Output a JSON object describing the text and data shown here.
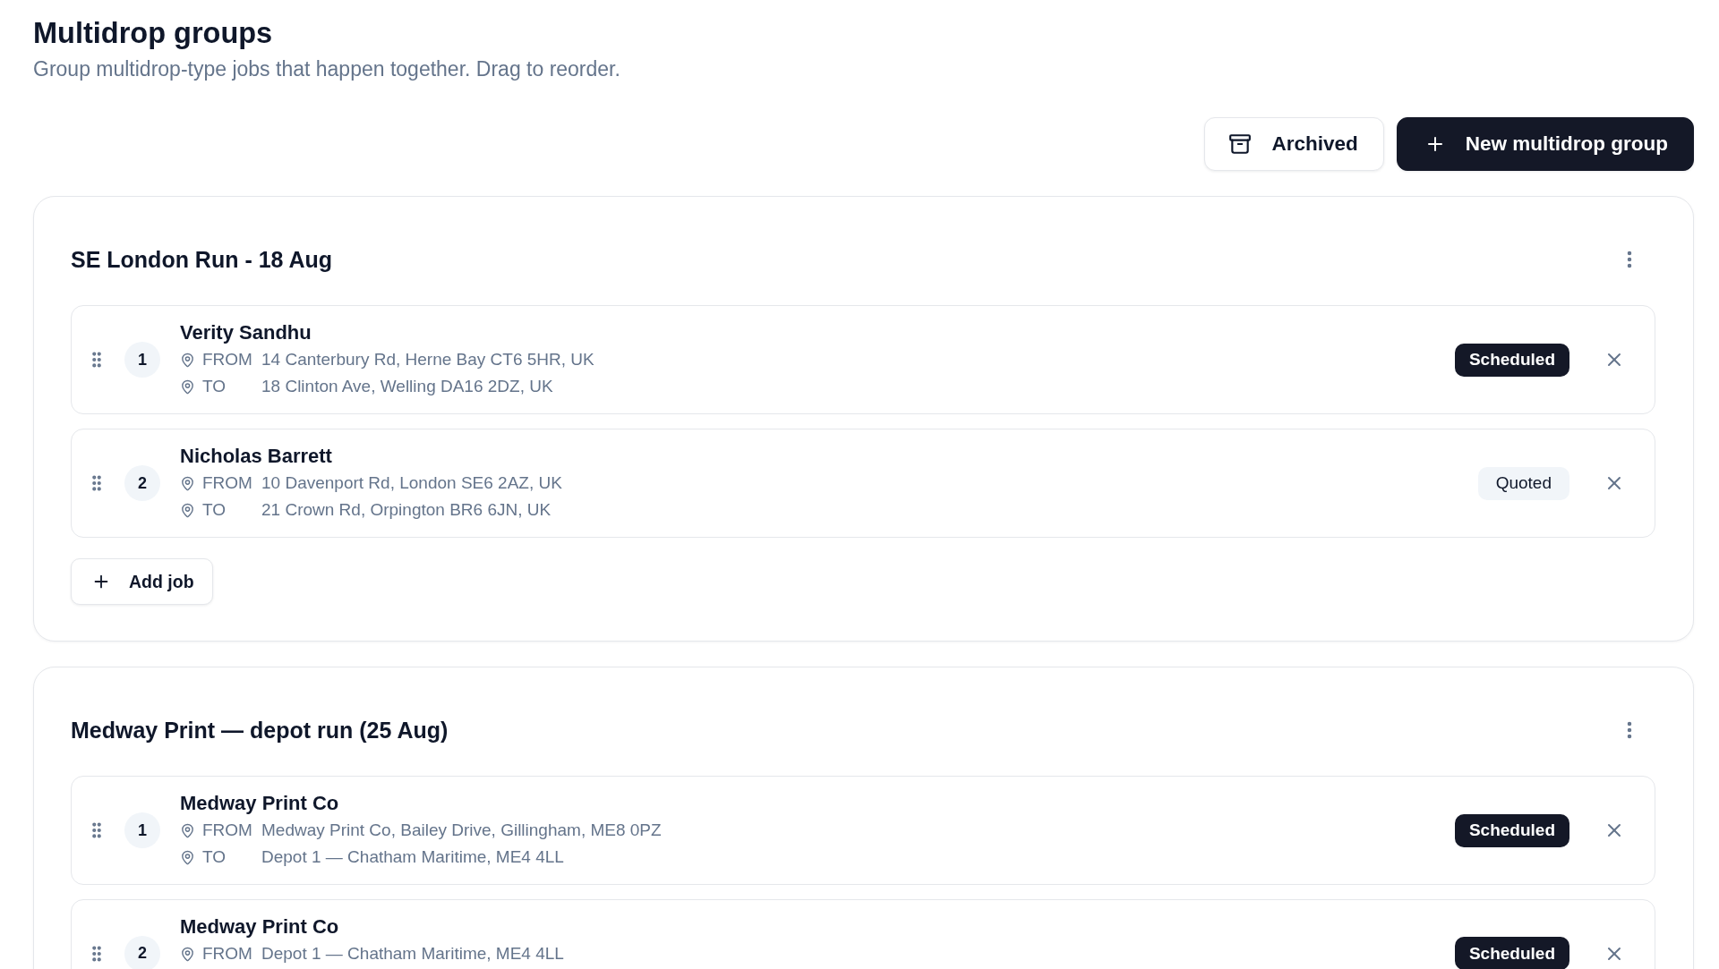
{
  "page": {
    "title": "Multidrop groups",
    "subtitle": "Group multidrop-type jobs that happen together. Drag to reorder."
  },
  "actions": [
    {
      "kind": "secondary",
      "label": "Archived"
    },
    {
      "kind": "primary",
      "label": "New multidrop group"
    }
  ],
  "groups": [
    {
      "title": "SE London Run - 18 Aug",
      "jobs": [
        {
          "number": "1",
          "name": "Verity Sandhu",
          "stops": [
            {
              "label": "FROM",
              "address": "14 Canterbury Rd, Herne Bay CT6 5HR, UK"
            },
            {
              "label": "TO",
              "address": "18 Clinton Ave, Welling DA16 2DZ, UK"
            }
          ],
          "status": {
            "kind": "scheduled",
            "label": "Scheduled"
          }
        },
        {
          "number": "2",
          "name": "Nicholas Barrett",
          "stops": [
            {
              "label": "FROM",
              "address": "10 Davenport Rd, London SE6 2AZ, UK"
            },
            {
              "label": "TO",
              "address": "21 Crown Rd, Orpington BR6 6JN, UK"
            }
          ],
          "status": {
            "kind": "quoted",
            "label": "Quoted"
          }
        }
      ],
      "add_job": "Add job"
    },
    {
      "title": "Medway Print — depot run (25 Aug)",
      "jobs": [
        {
          "number": "1",
          "name": "Medway Print Co",
          "stops": [
            {
              "label": "FROM",
              "address": "Medway Print Co, Bailey Drive, Gillingham, ME8 0PZ"
            },
            {
              "label": "TO",
              "address": "Depot 1 — Chatham Maritime, ME4 4LL"
            }
          ],
          "status": {
            "kind": "scheduled",
            "label": "Scheduled"
          }
        },
        {
          "number": "2",
          "name": "Medway Print Co",
          "stops": [
            {
              "label": "FROM",
              "address": "Depot 1 — Chatham Maritime, ME4 4LL"
            }
          ],
          "status": {
            "kind": "scheduled",
            "label": "Scheduled"
          }
        }
      ]
    }
  ]
}
